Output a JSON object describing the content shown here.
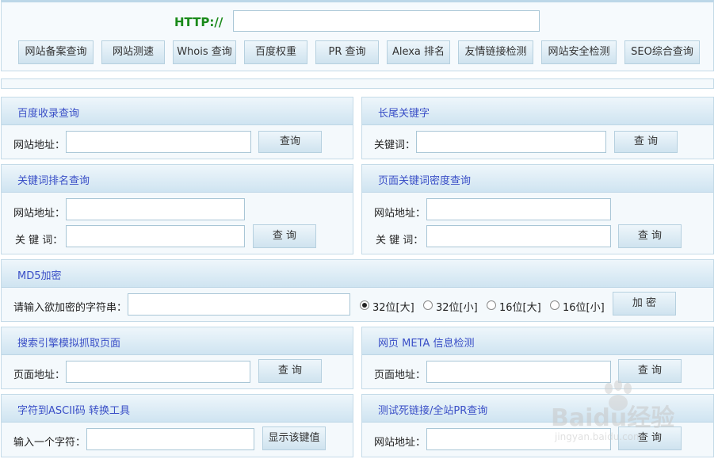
{
  "top": {
    "http_label": "HTTP://",
    "url_value": "",
    "tools": [
      "网站备案查询",
      "网站测速",
      "Whois 查询",
      "百度权重",
      "PR 查询",
      "Alexa 排名",
      "友情链接检测",
      "网站安全检测",
      "SEO综合查询"
    ]
  },
  "panels": {
    "baidu_index": {
      "title": "百度收录查询",
      "site_label": "网站地址：",
      "btn": "查询"
    },
    "long_tail": {
      "title": "长尾关键字",
      "kw_label": "关键词：",
      "btn": "查 询"
    },
    "kw_rank": {
      "title": "关键词排名查询",
      "site_label": "网站地址：",
      "kw_label": "关 键 词：",
      "btn": "查 询"
    },
    "kw_density": {
      "title": "页面关键词密度查询",
      "site_label": "网站地址：",
      "kw_label": "关 键 词：",
      "btn": "查 询"
    },
    "md5": {
      "title": "MD5加密",
      "prompt": "请输入欲加密的字符串：",
      "options": [
        "32位[大]",
        "32位[小]",
        "16位[大]",
        "16位[小]"
      ],
      "selected": 0,
      "btn": "加 密"
    },
    "spider": {
      "title": "搜索引擎模拟抓取页面",
      "page_label": "页面地址：",
      "btn": "查 询"
    },
    "meta": {
      "title": "网页 META 信息检测",
      "page_label": "页面地址：",
      "btn": "查 询"
    },
    "ascii": {
      "title": "字符到ASCII码 转换工具",
      "char_label": "输入一个字符：",
      "btn": "显示该键值"
    },
    "deadlink": {
      "title": "测试死链接/全站PR查询",
      "site_label": "网站地址：",
      "btn": "查 询"
    }
  },
  "watermark": {
    "brand": "Baidu经验",
    "url": "jingyan.baidu.com"
  },
  "colors": {
    "title": "#3a4fc7",
    "http": "#1a8a1a",
    "panel_border": "#c5dbe8"
  }
}
